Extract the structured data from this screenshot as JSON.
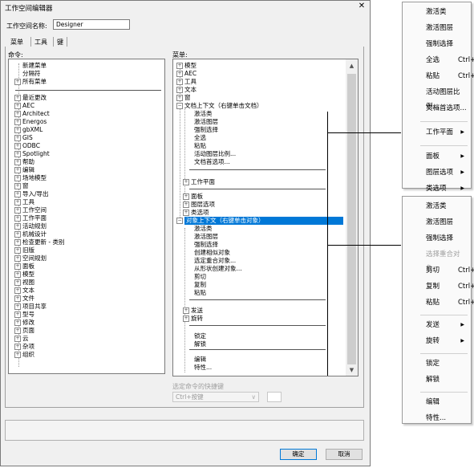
{
  "dialog": {
    "title": "工作空间编辑器",
    "close_glyph": "✕",
    "workspace_label": "工作空间名称:",
    "workspace_value": "Designer",
    "tabs": [
      {
        "label": "菜单"
      },
      {
        "label": "工具"
      },
      {
        "label": "键"
      }
    ],
    "commands_label": "命令:",
    "menus_label": "菜单:",
    "commands": [
      {
        "label": "新建菜单",
        "exp": false
      },
      {
        "label": "分隔符",
        "exp": false
      },
      {
        "label": "所有菜单",
        "exp": true
      },
      {
        "label": "最近更改",
        "exp": true
      },
      {
        "label": "AEC",
        "exp": true
      },
      {
        "label": "Architect",
        "exp": true
      },
      {
        "label": "Energos",
        "exp": true
      },
      {
        "label": "gbXML",
        "exp": true
      },
      {
        "label": "GIS",
        "exp": true
      },
      {
        "label": "ODBC",
        "exp": true
      },
      {
        "label": "Spotlight",
        "exp": true
      },
      {
        "label": "帮助",
        "exp": true
      },
      {
        "label": "编辑",
        "exp": true
      },
      {
        "label": "场地模型",
        "exp": true
      },
      {
        "label": "窗",
        "exp": true
      },
      {
        "label": "导入/导出",
        "exp": true
      },
      {
        "label": "工具",
        "exp": true
      },
      {
        "label": "工作空间",
        "exp": true
      },
      {
        "label": "工作平面",
        "exp": true
      },
      {
        "label": "活动规划",
        "exp": true
      },
      {
        "label": "机械设计",
        "exp": true
      },
      {
        "label": "检查更新 - 类别",
        "exp": true
      },
      {
        "label": "旧版",
        "exp": true
      },
      {
        "label": "空间规划",
        "exp": true
      },
      {
        "label": "面板",
        "exp": true
      },
      {
        "label": "模型",
        "exp": true
      },
      {
        "label": "视图",
        "exp": true
      },
      {
        "label": "文本",
        "exp": true
      },
      {
        "label": "文件",
        "exp": true
      },
      {
        "label": "项目共享",
        "exp": true
      },
      {
        "label": "型号",
        "exp": true
      },
      {
        "label": "修改",
        "exp": true
      },
      {
        "label": "页面",
        "exp": true
      },
      {
        "label": "云",
        "exp": true
      },
      {
        "label": "杂项",
        "exp": true
      },
      {
        "label": "组织",
        "exp": true
      }
    ],
    "menus": [
      {
        "label": "模型",
        "kind": "node",
        "sign": "+"
      },
      {
        "label": "AEC",
        "kind": "node",
        "sign": "+"
      },
      {
        "label": "工具",
        "kind": "node",
        "sign": "+"
      },
      {
        "label": "文本",
        "kind": "node",
        "sign": "+"
      },
      {
        "label": "窗",
        "kind": "node",
        "sign": "+"
      },
      {
        "label": "文档上下文（右键单击文档）",
        "kind": "node",
        "sign": "−"
      },
      {
        "label": "激活类",
        "kind": "item"
      },
      {
        "label": "激活图层",
        "kind": "item"
      },
      {
        "label": "强制选择",
        "kind": "item"
      },
      {
        "label": "全选",
        "kind": "item"
      },
      {
        "label": "粘贴",
        "kind": "item"
      },
      {
        "label": "活动图层比例...",
        "kind": "item"
      },
      {
        "label": "文档首选项...",
        "kind": "item"
      },
      {
        "label": "",
        "kind": "sep"
      },
      {
        "label": "工作平面",
        "kind": "subnode",
        "sign": "+"
      },
      {
        "label": "",
        "kind": "sep"
      },
      {
        "label": "面板",
        "kind": "subnode",
        "sign": "+"
      },
      {
        "label": "图层选项",
        "kind": "subnode",
        "sign": "+"
      },
      {
        "label": "类选项",
        "kind": "subnode",
        "sign": "+"
      },
      {
        "label": "对象上下文（右键单击对象）",
        "kind": "node",
        "sign": "−",
        "selected": true
      },
      {
        "label": "激活类",
        "kind": "item"
      },
      {
        "label": "激活图层",
        "kind": "item"
      },
      {
        "label": "强制选择",
        "kind": "item"
      },
      {
        "label": "创建相似对象",
        "kind": "item"
      },
      {
        "label": "选定重合对象...",
        "kind": "item"
      },
      {
        "label": "从形状创建对象...",
        "kind": "item"
      },
      {
        "label": "剪切",
        "kind": "item"
      },
      {
        "label": "复制",
        "kind": "item"
      },
      {
        "label": "粘贴",
        "kind": "item"
      },
      {
        "label": "",
        "kind": "sep"
      },
      {
        "label": "发送",
        "kind": "subnode",
        "sign": "+"
      },
      {
        "label": "旋转",
        "kind": "subnode",
        "sign": "+"
      },
      {
        "label": "",
        "kind": "sep"
      },
      {
        "label": "锁定",
        "kind": "item"
      },
      {
        "label": "解锁",
        "kind": "item"
      },
      {
        "label": "",
        "kind": "sep"
      },
      {
        "label": "编辑",
        "kind": "item"
      },
      {
        "label": "特性...",
        "kind": "item"
      }
    ],
    "shortcut_label": "选定命令的快捷键",
    "shortcut_select": "Ctrl+按键",
    "ok_label": "确定",
    "cancel_label": "取消"
  },
  "popup_doc": {
    "items": [
      {
        "label": "激活类",
        "key": ""
      },
      {
        "label": "激活图层",
        "key": ""
      },
      {
        "label": "强制选择",
        "key": ""
      },
      {
        "label": "全选",
        "key": "Ctrl+A"
      },
      {
        "label": "粘贴",
        "key": "Ctrl+V"
      },
      {
        "label": "活动图层比例...",
        "key": ""
      },
      {
        "label": "文档首选项...",
        "key": ""
      },
      {
        "sep": true
      },
      {
        "label": "工作平面",
        "key": "",
        "submenu": true
      },
      {
        "sep": true
      },
      {
        "label": "面板",
        "key": "",
        "submenu": true
      },
      {
        "label": "图层选项",
        "key": "",
        "submenu": true
      },
      {
        "label": "类选项",
        "key": "",
        "submenu": true
      }
    ]
  },
  "popup_obj": {
    "items": [
      {
        "label": "激活类",
        "key": ""
      },
      {
        "label": "激活图层",
        "key": ""
      },
      {
        "label": "强制选择",
        "key": ""
      },
      {
        "label": "选择重合对象...",
        "key": "",
        "disabled": true
      },
      {
        "label": "剪切",
        "key": "Ctrl+X"
      },
      {
        "label": "复制",
        "key": "Ctrl+C"
      },
      {
        "label": "粘贴",
        "key": "Ctrl+V"
      },
      {
        "sep": true
      },
      {
        "label": "发送",
        "key": "",
        "submenu": true
      },
      {
        "label": "旋转",
        "key": "",
        "submenu": true
      },
      {
        "sep": true
      },
      {
        "label": "锁定",
        "key": ""
      },
      {
        "label": "解锁",
        "key": ""
      },
      {
        "sep": true
      },
      {
        "label": "编辑",
        "key": ""
      },
      {
        "label": "特性...",
        "key": ""
      }
    ]
  },
  "icons": {
    "submenu_arrow": "▶",
    "scroll_up": "▲",
    "scroll_down": "▼",
    "select_arrow": "∨"
  }
}
